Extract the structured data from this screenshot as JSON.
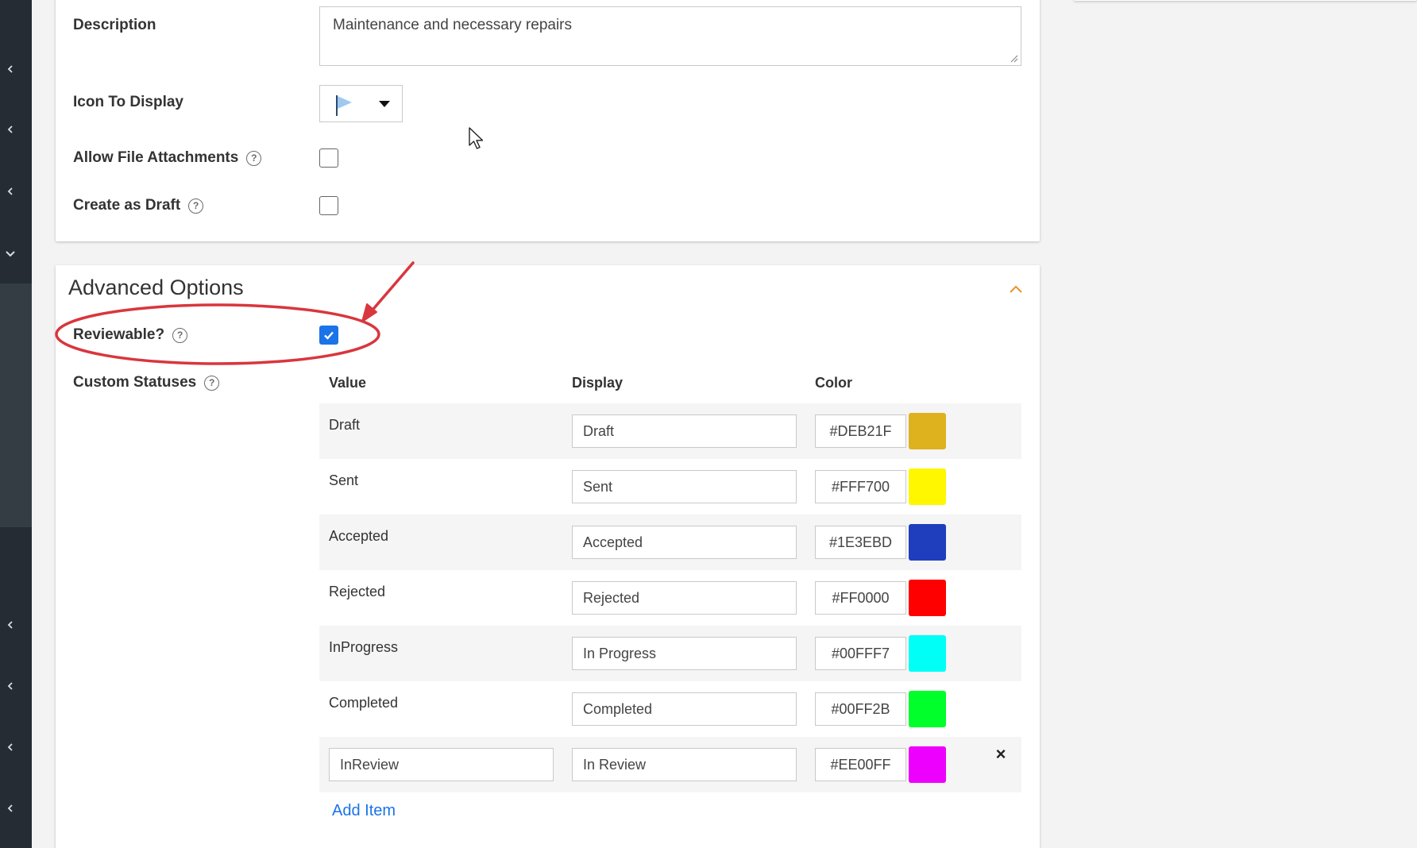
{
  "form": {
    "description_label": "Description",
    "description_value": "Maintenance and necessary repairs",
    "icon_label": "Icon To Display",
    "icon_name": "flag-icon",
    "allow_attachments_label": "Allow File Attachments",
    "create_draft_label": "Create as Draft",
    "help_glyph": "?"
  },
  "advanced": {
    "title": "Advanced Options",
    "reviewable_label": "Reviewable?",
    "custom_statuses_label": "Custom Statuses",
    "columns": {
      "value": "Value",
      "display": "Display",
      "color": "Color"
    },
    "statuses": [
      {
        "value": "Draft",
        "display": "Draft",
        "color": "#DEB21F",
        "editable": false
      },
      {
        "value": "Sent",
        "display": "Sent",
        "color": "#FFF700",
        "editable": false
      },
      {
        "value": "Accepted",
        "display": "Accepted",
        "color": "#1E3EBD",
        "editable": false
      },
      {
        "value": "Rejected",
        "display": "Rejected",
        "color": "#FF0000",
        "editable": false
      },
      {
        "value": "InProgress",
        "display": "In Progress",
        "color": "#00FFF7",
        "editable": false
      },
      {
        "value": "Completed",
        "display": "Completed",
        "color": "#00FF2B",
        "editable": false
      },
      {
        "value": "InReview",
        "display": "In Review",
        "color": "#EE00FF",
        "editable": true
      }
    ],
    "remove_glyph": "×",
    "add_item_label": "Add Item"
  },
  "colors": {
    "rail": "#252c33",
    "accent": "#1a73e8",
    "annotation": "#d9363e",
    "chevron_orange": "#e8912d"
  }
}
